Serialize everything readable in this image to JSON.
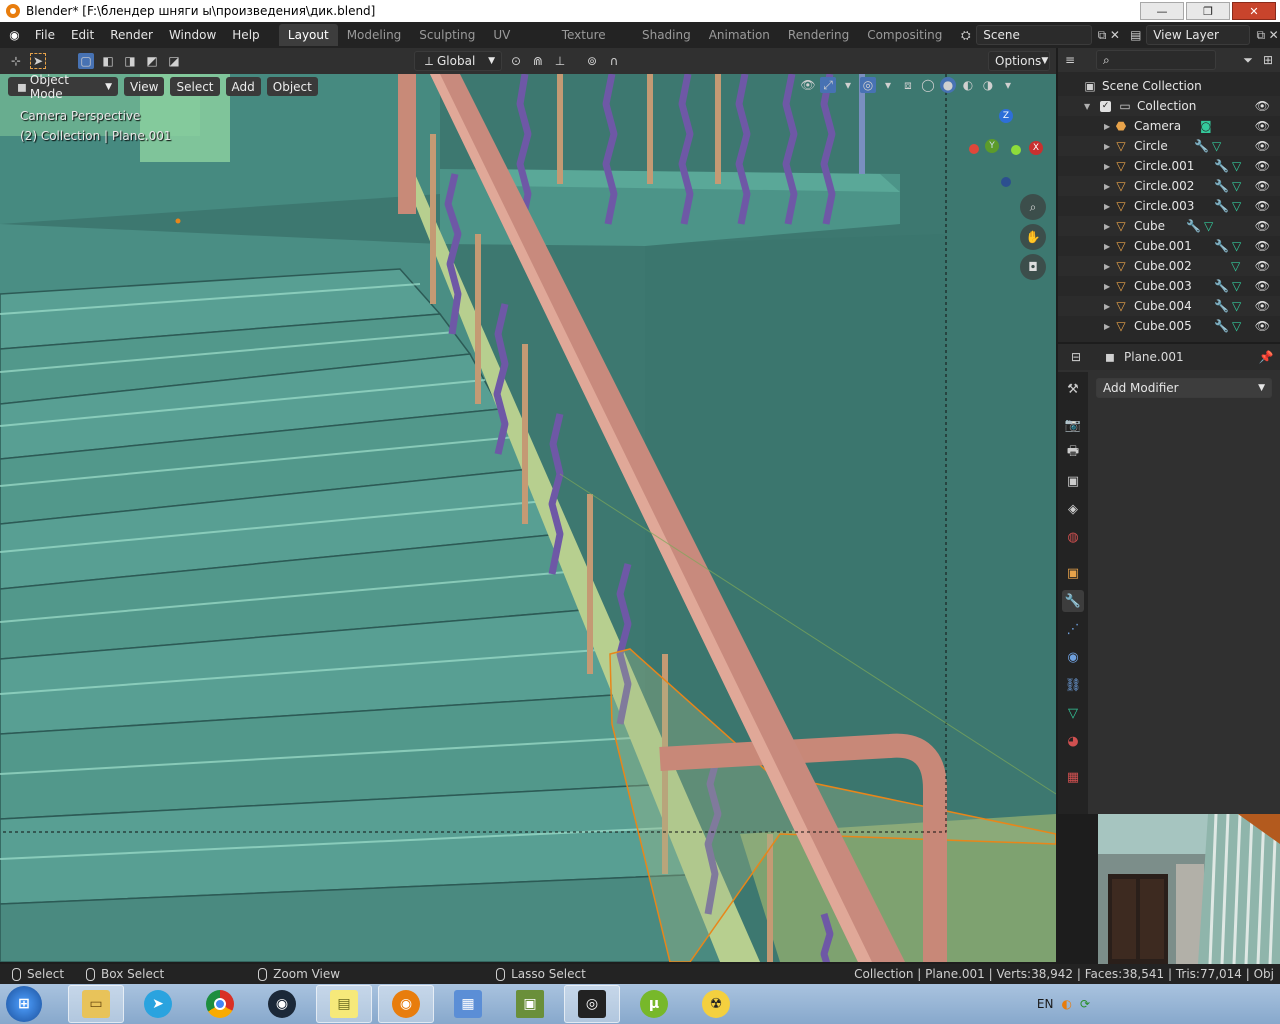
{
  "window": {
    "title": "Blender* [F:\\блендер шняги ы\\произведения\\дик.blend]",
    "minimize": "—",
    "restore": "❐",
    "close": "✕"
  },
  "menu": [
    "File",
    "Edit",
    "Render",
    "Window",
    "Help"
  ],
  "workspaces": [
    "Layout",
    "Modeling",
    "Sculpting",
    "UV Editing",
    "Texture Paint",
    "Shading",
    "Animation",
    "Rendering",
    "Compositing"
  ],
  "active_workspace": "Layout",
  "scene": {
    "label": "Scene",
    "view_layer": "View Layer"
  },
  "toolbar": {
    "orientation": "Global",
    "options": "Options"
  },
  "viewport_header": {
    "mode": "Object Mode",
    "view": "View",
    "select": "Select",
    "add": "Add",
    "object": "Object"
  },
  "viewport": {
    "camera_label": "Camera Perspective",
    "collection_label": "(2) Collection | Plane.001",
    "gizmo": {
      "z": "Z",
      "y": "Y",
      "x": "X"
    }
  },
  "outliner": {
    "root": "Scene Collection",
    "collection": "Collection",
    "items": [
      {
        "name": "Camera",
        "type": "camera"
      },
      {
        "name": "Circle",
        "type": "mesh"
      },
      {
        "name": "Circle.001",
        "type": "mesh"
      },
      {
        "name": "Circle.002",
        "type": "mesh"
      },
      {
        "name": "Circle.003",
        "type": "mesh"
      },
      {
        "name": "Cube",
        "type": "mesh"
      },
      {
        "name": "Cube.001",
        "type": "mesh"
      },
      {
        "name": "Cube.002",
        "type": "mesh"
      },
      {
        "name": "Cube.003",
        "type": "mesh"
      },
      {
        "name": "Cube.004",
        "type": "mesh"
      },
      {
        "name": "Cube.005",
        "type": "mesh"
      }
    ]
  },
  "properties": {
    "object_name": "Plane.001",
    "add_modifier": "Add Modifier"
  },
  "statusbar": {
    "select": "Select",
    "box_select": "Box Select",
    "zoom_view": "Zoom View",
    "lasso_select": "Lasso Select",
    "stats": "Collection | Plane.001 | Verts:38,942 | Faces:38,541 | Tris:77,014 | Obj"
  },
  "taskbar": {
    "lang": "EN"
  },
  "colors": {
    "accent_blue": "#4772b3",
    "orange": "#e8a34a",
    "mesh_green": "#34c99b",
    "wall_teal": "#3f7a72"
  }
}
